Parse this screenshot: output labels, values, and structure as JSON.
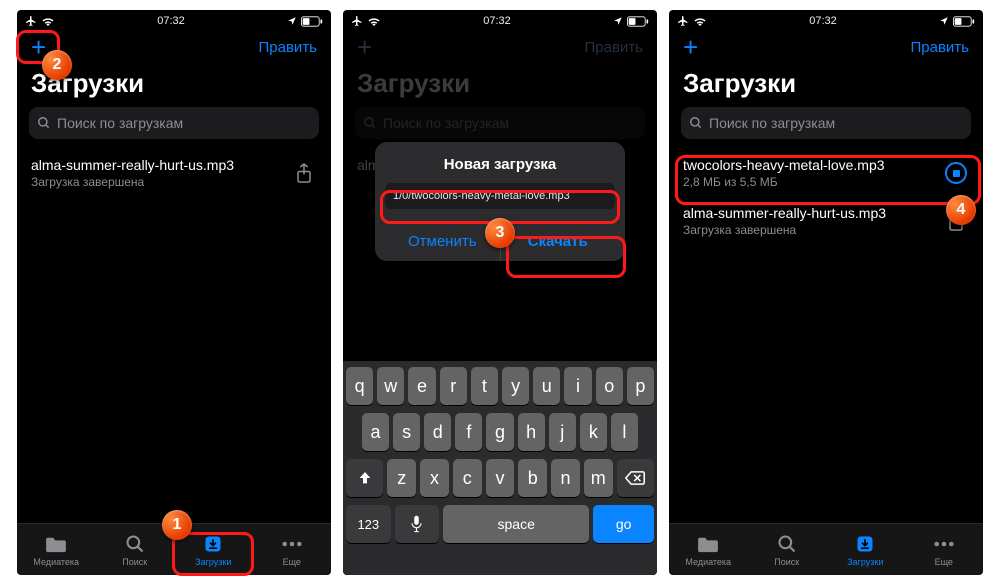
{
  "status": {
    "time": "07:32"
  },
  "nav": {
    "edit": "Править"
  },
  "title": "Загрузки",
  "search": {
    "placeholder": "Поиск по загрузкам"
  },
  "screen1": {
    "file": {
      "name": "alma-summer-really-hurt-us.mp3",
      "sub": "Загрузка завершена"
    }
  },
  "screen2": {
    "file_preview": "alma",
    "modal": {
      "title": "Новая загрузка",
      "url": "1/0/twocolors-heavy-metal-love.mp3",
      "cancel": "Отменить",
      "ok": "Скачать"
    }
  },
  "screen3": {
    "file1": {
      "name": "twocolors-heavy-metal-love.mp3",
      "sub": "2,8 МБ из 5,5 МБ"
    },
    "file2": {
      "name": "alma-summer-really-hurt-us.mp3",
      "sub": "Загрузка завершена"
    }
  },
  "tabs": {
    "library": "Медиатека",
    "search": "Поиск",
    "downloads": "Загрузки",
    "more": "Еще"
  },
  "keyboard": {
    "r1": [
      "q",
      "w",
      "e",
      "r",
      "t",
      "y",
      "u",
      "i",
      "o",
      "p"
    ],
    "r2": [
      "a",
      "s",
      "d",
      "f",
      "g",
      "h",
      "j",
      "k",
      "l"
    ],
    "r3": [
      "z",
      "x",
      "c",
      "v",
      "b",
      "n",
      "m"
    ],
    "num": "123",
    "space": "space",
    "go": "go"
  },
  "callouts": {
    "1": "1",
    "2": "2",
    "3": "3",
    "4": "4"
  }
}
